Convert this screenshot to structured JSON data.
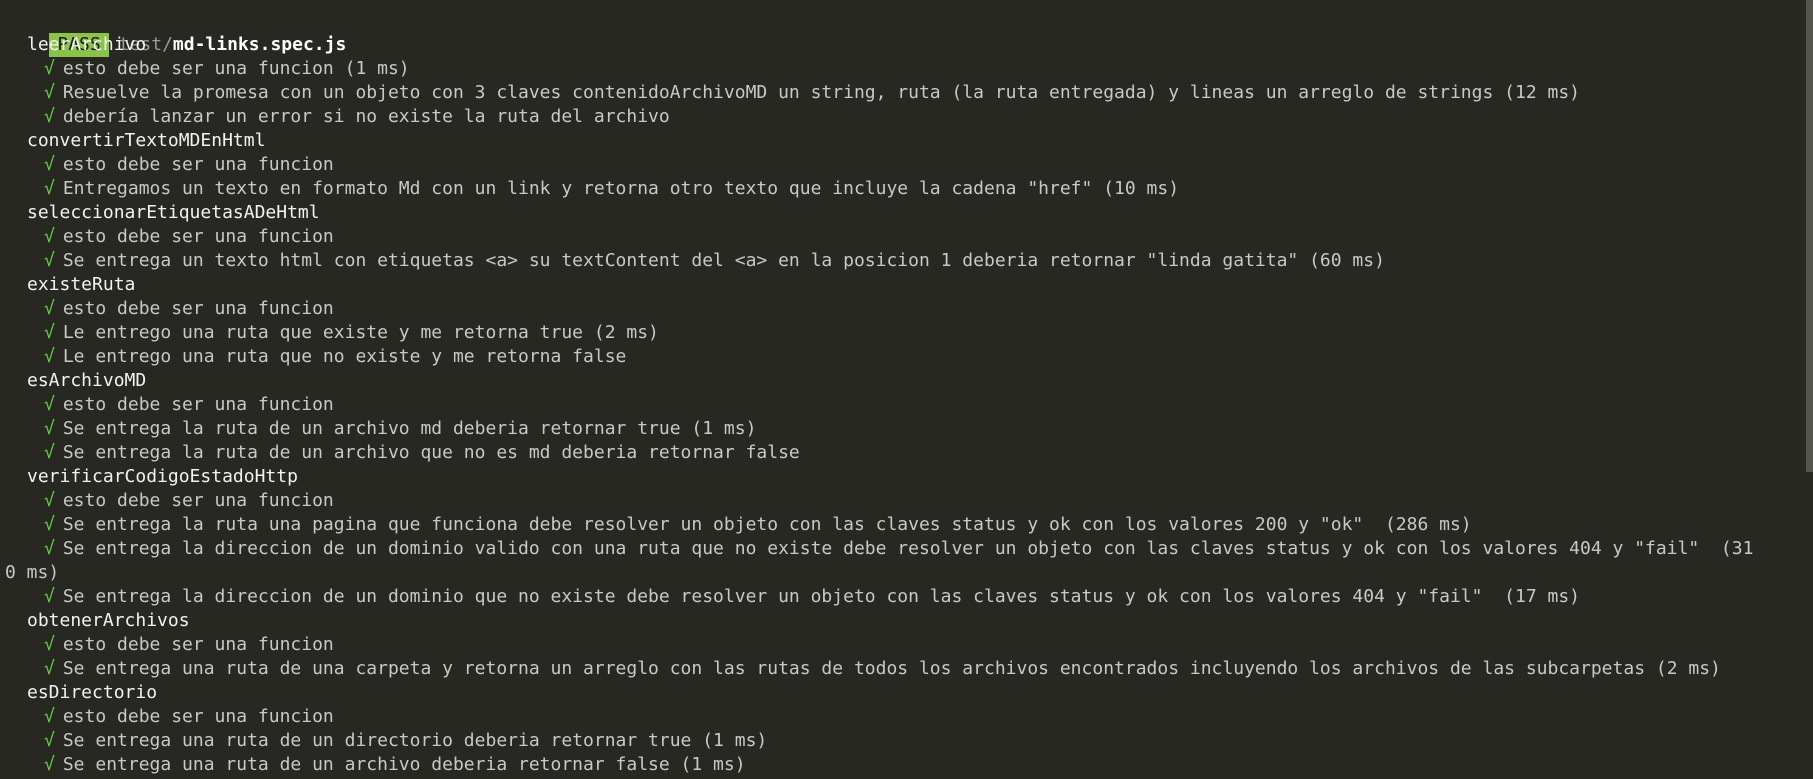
{
  "header": {
    "badge": "PASS",
    "path_dir": "test/",
    "path_file": "md-links.spec.js"
  },
  "check_mark": "√",
  "suites": [
    {
      "name": "leerArchivo",
      "tests": [
        {
          "text": "esto debe ser una funcion (1 ms)"
        },
        {
          "text": "Resuelve la promesa con un objeto con 3 claves contenidoArchivoMD un string, ruta (la ruta entregada) y lineas un arreglo de strings (12 ms)"
        },
        {
          "text": "debería lanzar un error si no existe la ruta del archivo"
        }
      ]
    },
    {
      "name": "convertirTextoMDEnHtml",
      "tests": [
        {
          "text": "esto debe ser una funcion"
        },
        {
          "text": "Entregamos un texto en formato Md con un link y retorna otro texto que incluye la cadena \"href\" (10 ms)"
        }
      ]
    },
    {
      "name": "seleccionarEtiquetasADeHtml",
      "tests": [
        {
          "text": "esto debe ser una funcion"
        },
        {
          "text": "Se entrega un texto html con etiquetas <a> su textContent del <a> en la posicion 1 deberia retornar \"linda gatita\" (60 ms)"
        }
      ]
    },
    {
      "name": "existeRuta",
      "tests": [
        {
          "text": "esto debe ser una funcion"
        },
        {
          "text": "Le entrego una ruta que existe y me retorna true (2 ms)"
        },
        {
          "text": "Le entrego una ruta que no existe y me retorna false"
        }
      ]
    },
    {
      "name": "esArchivoMD",
      "tests": [
        {
          "text": "esto debe ser una funcion"
        },
        {
          "text": "Se entrega la ruta de un archivo md deberia retornar true (1 ms)"
        },
        {
          "text": "Se entrega la ruta de un archivo que no es md deberia retornar false"
        }
      ]
    },
    {
      "name": "verificarCodigoEstadoHttp",
      "tests": [
        {
          "text": "esto debe ser una funcion"
        },
        {
          "text": "Se entrega la ruta una pagina que funciona debe resolver un objeto con las claves status y ok con los valores 200 y \"ok\"  (286 ms)"
        },
        {
          "text": "Se entrega la direccion de un dominio valido con una ruta que no existe debe resolver un objeto con las claves status y ok con los valores 404 y \"fail\"  (31",
          "continuation": "0 ms)"
        },
        {
          "text": "Se entrega la direccion de un dominio que no existe debe resolver un objeto con las claves status y ok con los valores 404 y \"fail\"  (17 ms)"
        }
      ]
    },
    {
      "name": "obtenerArchivos",
      "tests": [
        {
          "text": "esto debe ser una funcion"
        },
        {
          "text": "Se entrega una ruta de una carpeta y retorna un arreglo con las rutas de todos los archivos encontrados incluyendo los archivos de las subcarpetas (2 ms)"
        }
      ]
    },
    {
      "name": "esDirectorio",
      "tests": [
        {
          "text": "esto debe ser una funcion"
        },
        {
          "text": "Se entrega una ruta de un directorio deberia retornar true (1 ms)"
        },
        {
          "text": "Se entrega una ruta de un archivo deberia retornar false (1 ms)"
        }
      ]
    }
  ]
}
